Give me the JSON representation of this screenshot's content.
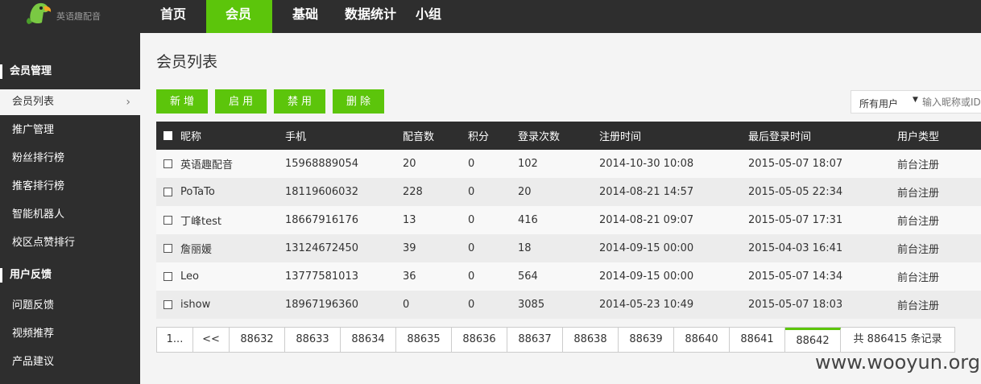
{
  "brand": {
    "name": "英语趣配音"
  },
  "topnav": [
    {
      "label": "首页",
      "active": false
    },
    {
      "label": "会员",
      "active": true
    },
    {
      "label": "基础",
      "active": false
    },
    {
      "label": "数据统计",
      "active": false
    },
    {
      "label": "小组",
      "active": false
    }
  ],
  "sidebar": {
    "group1": "会员管理",
    "group1_items": [
      "会员列表",
      "推广管理",
      "粉丝排行榜",
      "推客排行榜",
      "智能机器人",
      "校区点赞排行"
    ],
    "group2": "用户反馈",
    "group2_items": [
      "问题反馈",
      "视频推荐",
      "产品建议"
    ],
    "active_item": "会员列表"
  },
  "page_title": "会员列表",
  "buttons": {
    "add": "新增",
    "enable": "启用",
    "disable": "禁用",
    "delete": "删除"
  },
  "filter": {
    "selected": "所有用户",
    "search_placeholder": "输入昵称或ID"
  },
  "table": {
    "columns": [
      "昵称",
      "手机",
      "配音数",
      "积分",
      "登录次数",
      "注册时间",
      "最后登录时间",
      "用户类型"
    ],
    "rows": [
      [
        "英语趣配音",
        "15968889054",
        "20",
        "0",
        "102",
        "2014-10-30 10:08",
        "2015-05-07 18:07",
        "前台注册"
      ],
      [
        "PoTaTo",
        "18119606032",
        "228",
        "0",
        "20",
        "2014-08-21 14:57",
        "2015-05-05 22:34",
        "前台注册"
      ],
      [
        "丁峰test",
        "18667916176",
        "13",
        "0",
        "416",
        "2014-08-21 09:07",
        "2015-05-07 17:31",
        "前台注册"
      ],
      [
        "詹丽媛",
        "13124672450",
        "39",
        "0",
        "18",
        "2014-09-15 00:00",
        "2015-04-03 16:41",
        "前台注册"
      ],
      [
        "Leo",
        "13777581013",
        "36",
        "0",
        "564",
        "2014-09-15 00:00",
        "2015-05-07 14:34",
        "前台注册"
      ],
      [
        "ishow",
        "18967196360",
        "0",
        "0",
        "3085",
        "2014-05-23 10:49",
        "2015-05-07 18:03",
        "前台注册"
      ]
    ]
  },
  "pagination": {
    "first": "1...",
    "prev": "<<",
    "pages": [
      "88632",
      "88633",
      "88634",
      "88635",
      "88636",
      "88637",
      "88638",
      "88639",
      "88640",
      "88641",
      "88642"
    ],
    "current": "88642",
    "total": "共 886415 条记录"
  },
  "watermark": "www.wooyun.org",
  "colors": {
    "accent": "#5cc50b",
    "dark": "#2e2e2e"
  }
}
